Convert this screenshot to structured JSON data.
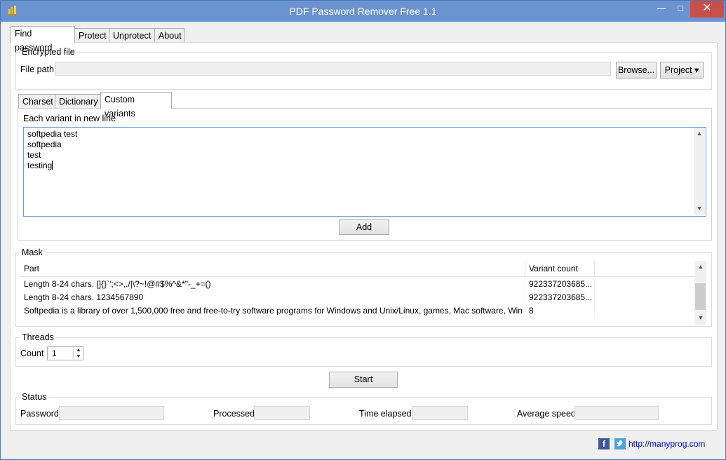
{
  "window": {
    "title": "PDF Password Remover Free 1.1",
    "minimize_glyph": "—",
    "maximize_glyph": "□",
    "close_glyph": "✕"
  },
  "tabs": [
    "Find password",
    "Protect",
    "Unprotect",
    "About"
  ],
  "encrypted_file": {
    "group_label": "Encrypted file",
    "file_path_label": "File path",
    "file_path_value": "",
    "browse_label": "Browse...",
    "project_label": "Project",
    "project_arrow": "▾"
  },
  "subtabs": [
    "Charset",
    "Dictionary",
    "Custom variants"
  ],
  "custom_variants": {
    "hint": "Each variant in new line",
    "lines": [
      "softpedia test",
      "softpedia",
      "test",
      "testing"
    ],
    "add_label": "Add"
  },
  "mask": {
    "group_label": "Mask",
    "columns": [
      "Part",
      "Variant count"
    ],
    "rows": [
      {
        "part": "Length 8-24 chars. []{}`';<>,./|\\?~!@#$%^&*\"-_+=()",
        "count": "922337203685..."
      },
      {
        "part": "Length 8-24 chars. 1234567890",
        "count": "922337203685..."
      },
      {
        "part": "Softpedia is a library of over 1,500,000 free and free-to-try software programs for Windows and Unix/Linux, games, Mac software, Win...",
        "count": "8"
      }
    ]
  },
  "threads": {
    "group_label": "Threads",
    "count_label": "Count",
    "count_value": "1"
  },
  "start_label": "Start",
  "status": {
    "group_label": "Status",
    "password_label": "Password",
    "processed_label": "Processed",
    "time_elapsed_label": "Time elapsed",
    "average_speed_label": "Average speed"
  },
  "footer": {
    "link": "http://manyprog.com"
  },
  "colors": {
    "title_bar": "#6a93cf",
    "close_button": "#c7504a",
    "facebook": "#3b5998",
    "twitter": "#4aa3df",
    "link": "#0000cc"
  }
}
